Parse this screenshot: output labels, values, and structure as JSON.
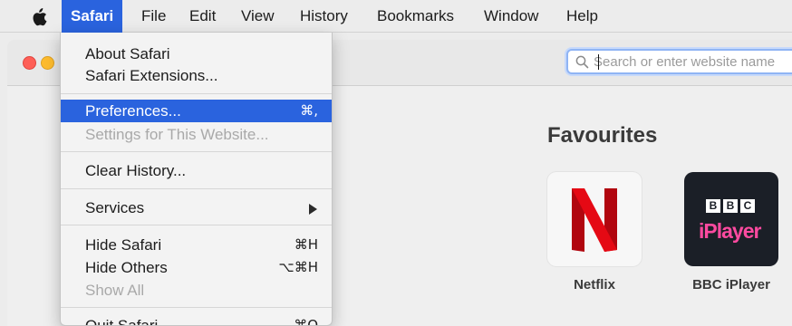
{
  "menubar": {
    "apple_icon": "apple-logo-icon",
    "items": [
      "Safari",
      "File",
      "Edit",
      "View",
      "History",
      "Bookmarks",
      "Window",
      "Help"
    ],
    "active": "Safari"
  },
  "safari_menu": {
    "about": "About Safari",
    "extensions": "Safari Extensions...",
    "preferences": "Preferences...",
    "preferences_shortcut": "⌘,",
    "settings_site": "Settings for This Website...",
    "clear_history": "Clear History...",
    "services": "Services",
    "hide_safari": "Hide Safari",
    "hide_safari_shortcut": "⌘H",
    "hide_others": "Hide Others",
    "hide_others_shortcut": "⌥⌘H",
    "show_all": "Show All",
    "quit": "Quit Safari",
    "quit_shortcut": "⌘Q"
  },
  "address_bar": {
    "placeholder": "Search or enter website name",
    "icon": "search-icon"
  },
  "favourites": {
    "title": "Favourites",
    "items": [
      {
        "label": "Netflix",
        "icon": "netflix-logo-icon"
      },
      {
        "label": "BBC iPlayer",
        "icon": "bbc-iplayer-logo-icon"
      }
    ],
    "bbc_letters": [
      "B",
      "B",
      "C"
    ],
    "iplayer_text": "iPlayer"
  },
  "colors": {
    "menu_highlight": "#2a63de",
    "netflix_red": "#e50914",
    "bbc_tile": "#1b1f27",
    "iplayer_pink": "#ff4aa0"
  }
}
